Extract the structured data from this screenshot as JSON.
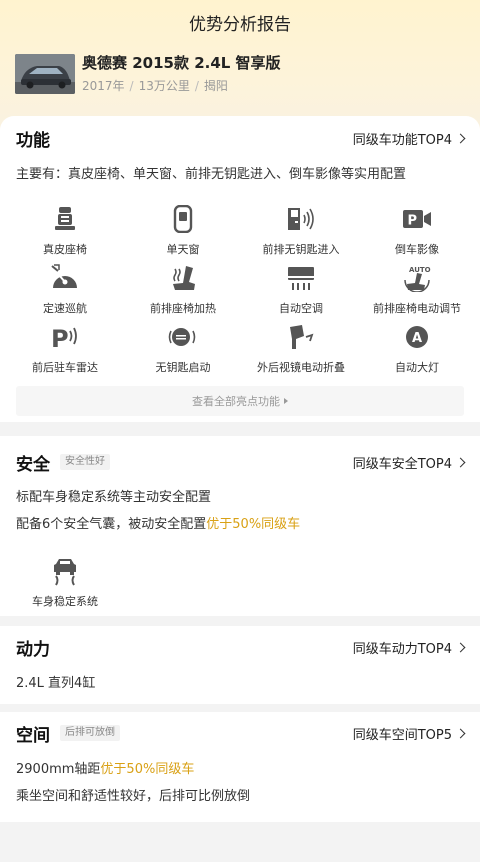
{
  "header": {
    "title": "优势分析报告"
  },
  "car": {
    "name": "奥德赛 2015款 2.4L 智享版",
    "year": "2017年",
    "mileage": "13万公里",
    "city": "揭阳",
    "separator": "/"
  },
  "features": {
    "title": "功能",
    "link": "同级车功能TOP4",
    "summary": "主要有：真皮座椅、单天窗、前排无钥匙进入、倒车影像等实用配置",
    "items": [
      {
        "label": "真皮座椅",
        "icon": "leather-seat-icon"
      },
      {
        "label": "单天窗",
        "icon": "sunroof-icon"
      },
      {
        "label": "前排无钥匙进入",
        "icon": "keyless-entry-icon"
      },
      {
        "label": "倒车影像",
        "icon": "reverse-camera-icon"
      },
      {
        "label": "定速巡航",
        "icon": "cruise-control-icon"
      },
      {
        "label": "前排座椅加热",
        "icon": "seat-heating-icon"
      },
      {
        "label": "自动空调",
        "icon": "auto-ac-icon"
      },
      {
        "label": "前排座椅电动调节",
        "icon": "power-seat-icon"
      },
      {
        "label": "前后驻车雷达",
        "icon": "parking-radar-icon"
      },
      {
        "label": "无钥匙启动",
        "icon": "keyless-start-icon"
      },
      {
        "label": "外后视镜电动折叠",
        "icon": "mirror-fold-icon"
      },
      {
        "label": "自动大灯",
        "icon": "auto-headlight-icon"
      }
    ],
    "more": "查看全部亮点功能"
  },
  "safety": {
    "title": "安全",
    "tag": "安全性好",
    "link": "同级车安全TOP4",
    "line1": "标配车身稳定系统等主动安全配置",
    "line2_prefix": "配备6个安全气囊，被动安全配置",
    "line2_highlight": "优于50%同级车",
    "item": {
      "label": "车身稳定系统",
      "icon": "stability-control-icon"
    }
  },
  "power": {
    "title": "动力",
    "link": "同级车动力TOP4",
    "line": "2.4L 直列4缸"
  },
  "space": {
    "title": "空间",
    "tag": "后排可放倒",
    "link": "同级车空间TOP5",
    "line1_prefix": "2900mm轴距",
    "line1_highlight": "优于50%同级车",
    "line2": "乘坐空间和舒适性较好，后排可比例放倒"
  },
  "colors": {
    "highlight": "#d9a116",
    "icon": "#555555"
  }
}
